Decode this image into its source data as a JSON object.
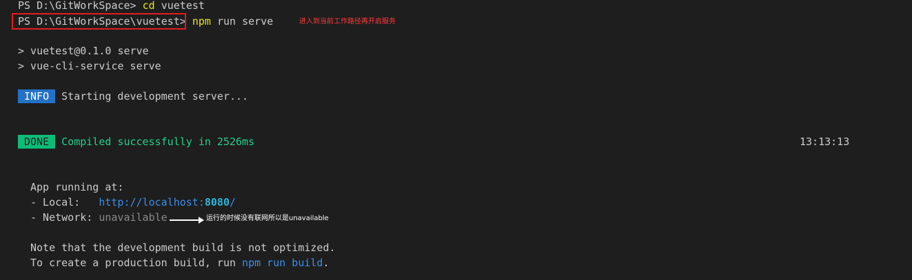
{
  "terminal": {
    "line1": {
      "prompt": "PS D:\\GitWorkSpace> ",
      "command": "cd",
      "arg": " vuetest"
    },
    "line2": {
      "prompt": "PS D:\\GitWorkSpace\\vuetest> ",
      "command": "npm",
      "arg": " run serve"
    },
    "script_lines": [
      "> vuetest@0.1.0 serve",
      "> vue-cli-service serve"
    ],
    "info": {
      "tag": "INFO",
      "text": " Starting development server..."
    },
    "done": {
      "tag": "DONE",
      "text": " Compiled successfully in 2526ms",
      "time": "13:13:13"
    },
    "app_running": "App running at:",
    "local": {
      "label": "- Local:   ",
      "url_prefix": "http://localhost:",
      "port": "8080",
      "url_suffix": "/"
    },
    "network": {
      "label": "- Network: ",
      "value": "unavailable"
    },
    "note1": "Note that the development build is not optimized.",
    "note2": {
      "prefix": "To create a production build, run ",
      "command": "npm run build",
      "suffix": "."
    }
  },
  "annotations": {
    "enter_dir": "进入到当前工作路径再开启服务",
    "network_note": "运行的时候没有联网所以是unavailable",
    "arrow_icon": "arrow-right-icon",
    "box_color": "#e51d1d"
  },
  "colors": {
    "background": "#1e1e1e",
    "text": "#cccccc",
    "yellow": "#e5e510",
    "green": "#23d18b",
    "info_tag": "#2472c8",
    "done_tag": "#0dbc79",
    "link": "#3b8eea"
  }
}
